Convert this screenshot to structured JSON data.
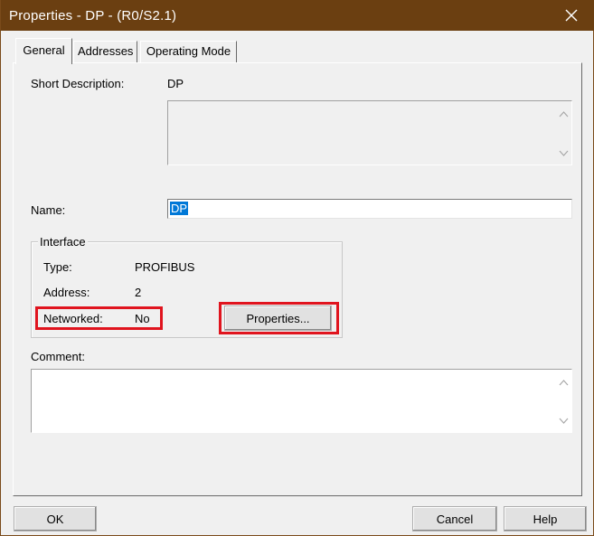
{
  "window": {
    "title": "Properties - DP - (R0/S2.1)"
  },
  "tabs": [
    {
      "label": "General"
    },
    {
      "label": "Addresses"
    },
    {
      "label": "Operating Mode"
    }
  ],
  "general": {
    "short_description_label": "Short Description:",
    "short_description_value": "DP",
    "name_label": "Name:",
    "name_value": "DP",
    "interface": {
      "title": "Interface",
      "type_label": "Type:",
      "type_value": "PROFIBUS",
      "address_label": "Address:",
      "address_value": "2",
      "networked_label": "Networked:",
      "networked_value": "No",
      "properties_button": "Properties..."
    },
    "comment_label": "Comment:"
  },
  "footer": {
    "ok_label": "OK",
    "cancel_label": "Cancel",
    "help_label": "Help"
  },
  "colors": {
    "titlebar": "#6b3f11",
    "highlight": "#e0141e",
    "selection": "#0078d7"
  }
}
